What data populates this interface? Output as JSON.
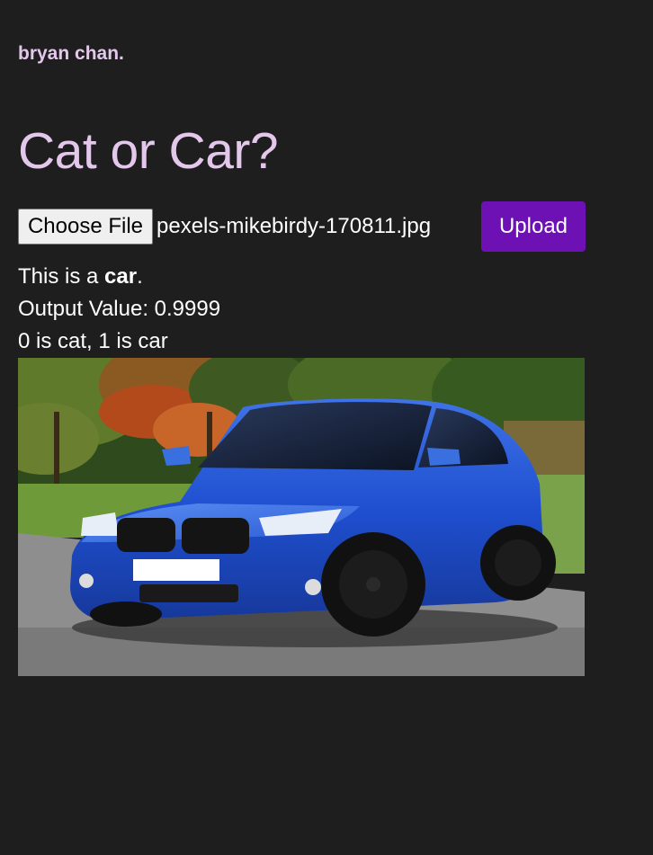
{
  "header": {
    "brand": "bryan chan."
  },
  "main": {
    "title": "Cat or Car?",
    "file_input": {
      "button_label": "Choose File",
      "file_name": "pexels-mikebirdy-170811.jpg"
    },
    "upload_label": "Upload",
    "result": {
      "prefix": "This is a ",
      "label": "car",
      "suffix": ".",
      "output_text": "Output Value: 0.9999",
      "legend": "0 is cat, 1 is car"
    }
  },
  "colors": {
    "background": "#1e1e1f",
    "heading": "#e4c8ec",
    "accent": "#6d11b4"
  }
}
